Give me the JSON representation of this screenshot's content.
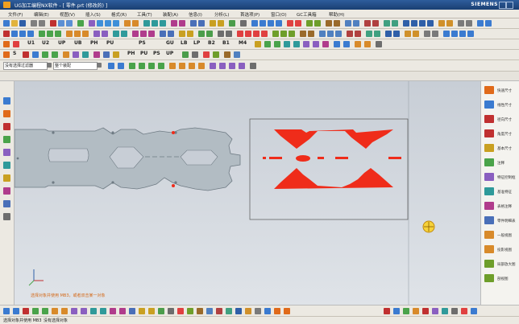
{
  "window": {
    "title": "UG加工编程NX软件 - [ 零件.prt (修改的) ]",
    "brand": "SIEMENS"
  },
  "menu": {
    "items": [
      "文件(F)",
      "编辑(E)",
      "视图(V)",
      "插入(S)",
      "格式(R)",
      "工具(T)",
      "装配(A)",
      "信息(I)",
      "分析(L)",
      "首选项(P)",
      "窗口(O)",
      "GC工具箱",
      "帮助(H)"
    ]
  },
  "toolbar_text": {
    "row3": [
      "U1",
      "U2",
      "UP",
      "UB",
      "PH",
      "PU",
      "PS",
      "GU",
      "LB",
      "LP",
      "B2",
      "B1",
      "M4"
    ],
    "row4": [
      "S",
      "PH",
      "PU",
      "PS",
      "UP"
    ]
  },
  "filters": {
    "selection_filter": "没有选择过滤器",
    "scope": "整个装配"
  },
  "canvas": {
    "hint": "选择对象并使用 MB3，或者双击某一对象"
  },
  "right_panel": {
    "items": [
      "快速尺寸",
      "线性尺寸",
      "径向尺寸",
      "角度尺寸",
      "基本尺寸",
      "注释",
      "特征控制框",
      "基准特征",
      "表格注释",
      "零件明细表",
      "一般视图",
      "投影视图",
      "局部放大图",
      "剖视图"
    ]
  },
  "status": {
    "left": "选择对象并使用 MB3",
    "right": "没有选择对象"
  },
  "colors": {
    "part_fill": "#b2bcc3",
    "part_stroke": "#6f7b84",
    "highlight": "#ef2c1a",
    "canvas_top": "#c8ced6",
    "canvas_bottom": "#dfe3e8"
  }
}
